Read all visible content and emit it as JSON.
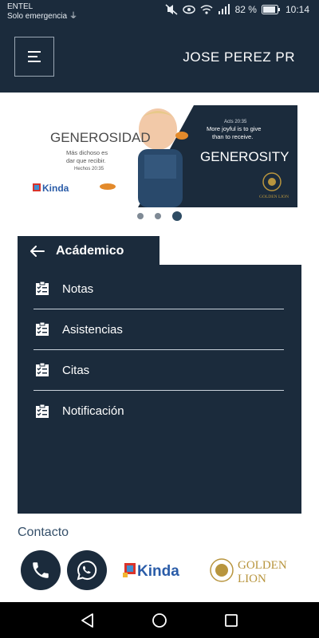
{
  "status": {
    "carrier": "ENTEL",
    "carrier_sub": "Solo emergencia",
    "battery": "82 %",
    "time": "10:14",
    "icons": [
      "usb-icon",
      "mute-icon",
      "eye-icon",
      "wifi-icon",
      "signal-icon",
      "battery-icon"
    ]
  },
  "header": {
    "menu_icon": "hamburger-menu-icon",
    "user_name": "JOSE PEREZ PR",
    "background": "#1b2b3c"
  },
  "banner": {
    "left_title": "GENEROSIDAD",
    "left_text_1": "Más dichoso es",
    "left_text_2": "dar que recibir.",
    "left_ref": "Hechos 20:35",
    "left_logo": "Kinda",
    "right_ref": "Acts 20:35",
    "right_text_1": "More joyful is to give",
    "right_text_2": "than to receive.",
    "right_title": "GENEROSITY",
    "right_logo": "GOLDEN LION",
    "slides": 3,
    "active_slide": 3
  },
  "academic": {
    "title": "Acádemico",
    "back_icon": "back-arrow-icon",
    "items": [
      {
        "label": "Notas",
        "icon": "checklist-icon"
      },
      {
        "label": "Asistencias",
        "icon": "checklist-icon"
      },
      {
        "label": "Citas",
        "icon": "checklist-icon"
      },
      {
        "label": "Notificación",
        "icon": "checklist-icon"
      }
    ]
  },
  "contact": {
    "title": "Contacto",
    "phone_icon": "phone-icon",
    "whatsapp_icon": "whatsapp-icon",
    "logo_1": "Kinda",
    "logo_2_line1": "GOLDEN",
    "logo_2_line2": "LION"
  },
  "nav": {
    "back_icon": "nav-back-icon",
    "home_icon": "nav-home-icon",
    "recents_icon": "nav-recents-icon"
  },
  "colors": {
    "primary": "#1b2b3c",
    "accent_dot": "#2d4b63",
    "contact_text": "#35506a",
    "gold": "#b8953e"
  }
}
